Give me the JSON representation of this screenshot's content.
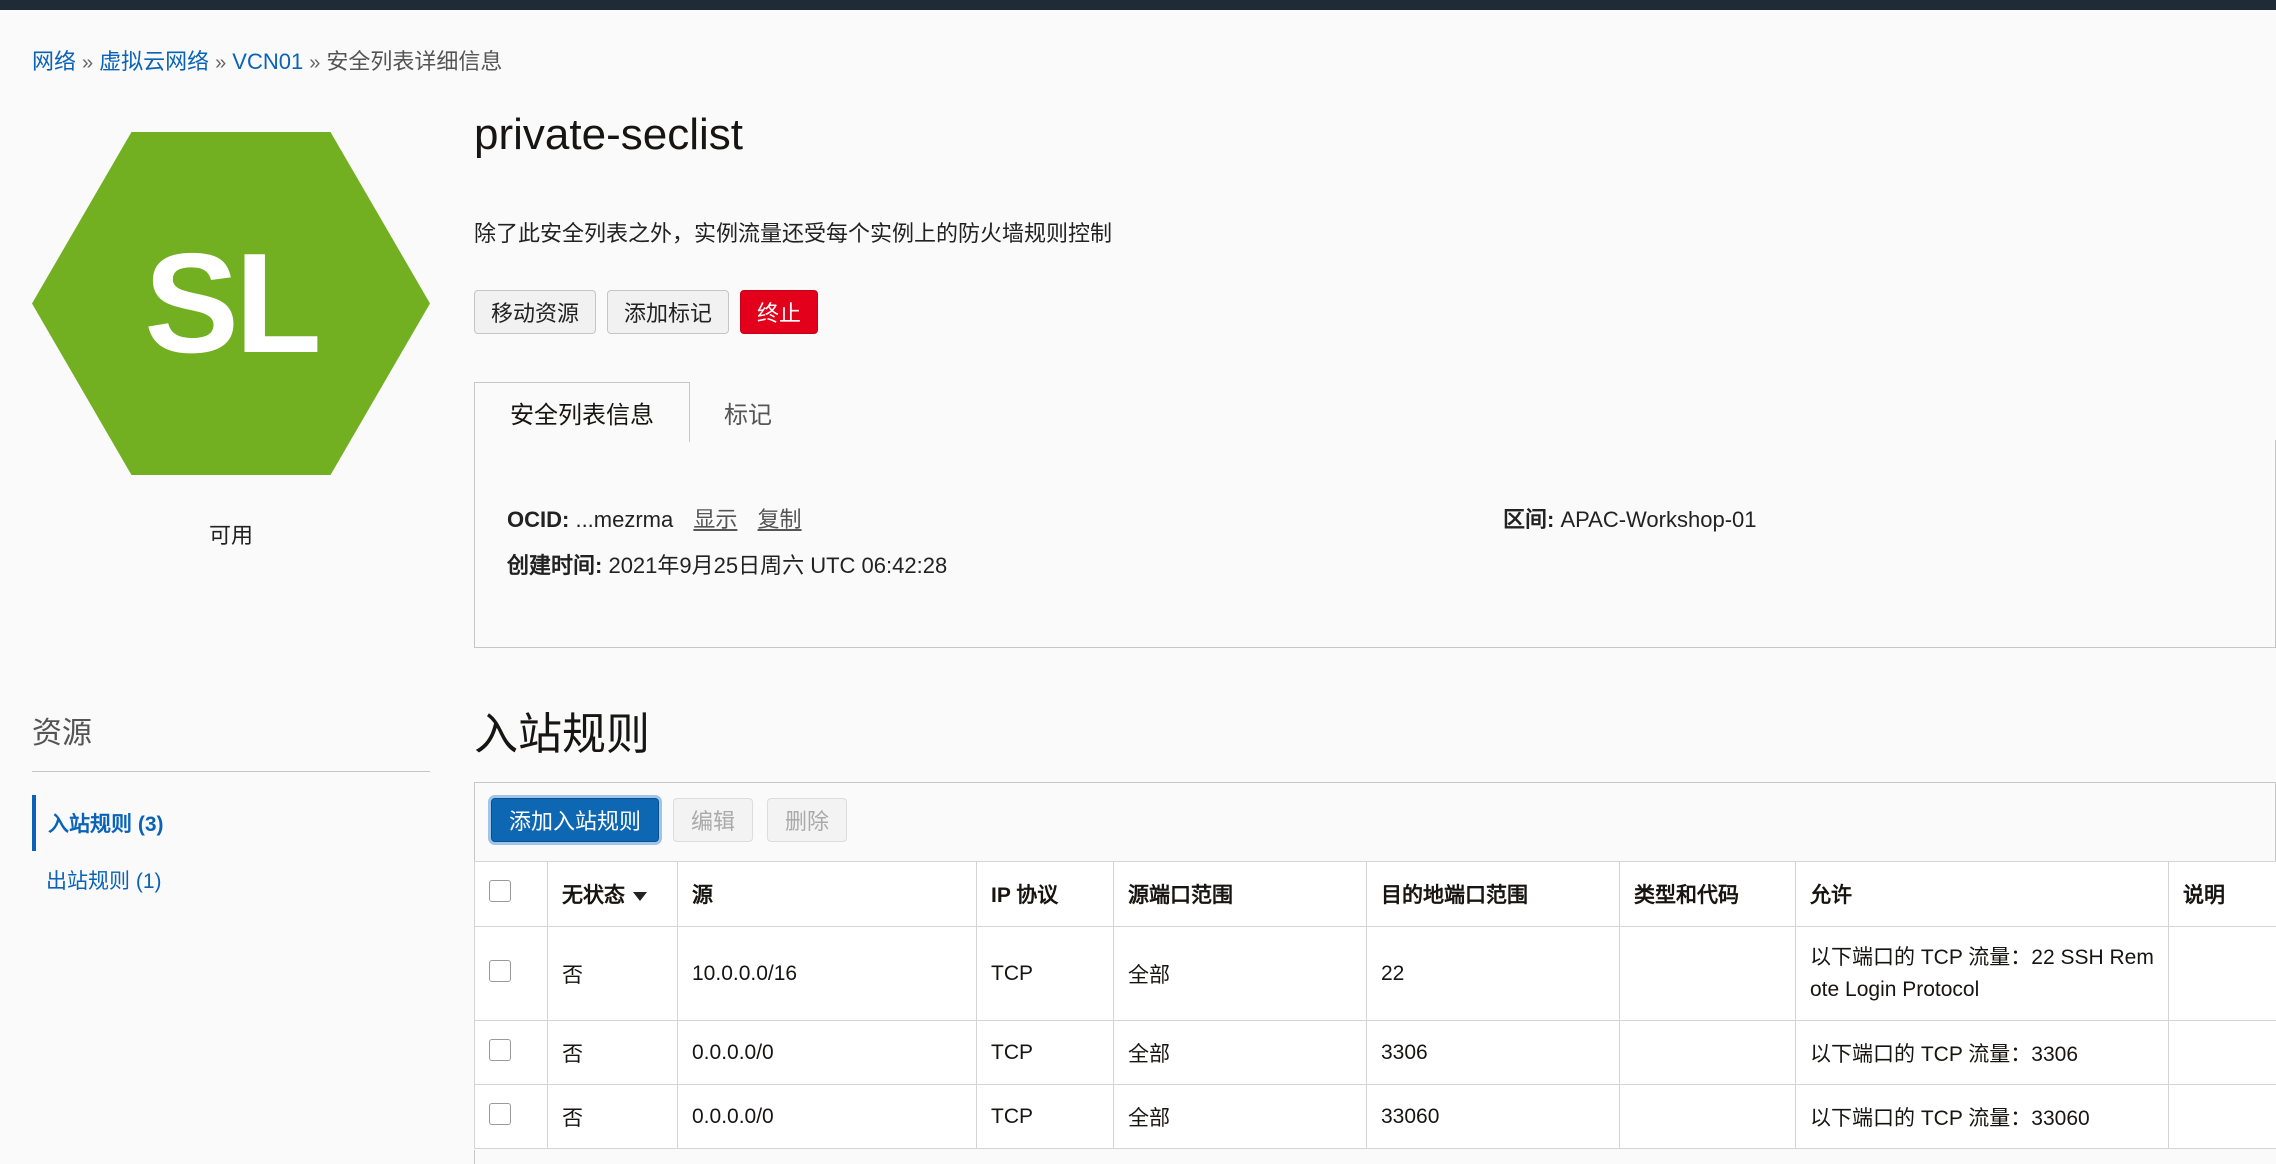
{
  "breadcrumb": {
    "items": [
      "网络",
      "虚拟云网络",
      "VCN01"
    ],
    "separator": "»",
    "current": "安全列表详细信息"
  },
  "resource_icon": {
    "initials": "SL",
    "status": "可用",
    "color": "#72b022"
  },
  "header": {
    "title": "private-seclist",
    "description": "除了此安全列表之外，实例流量还受每个实例上的防火墙规则控制"
  },
  "actions": {
    "move": "移动资源",
    "add_tags": "添加标记",
    "terminate": "终止"
  },
  "tabs": [
    {
      "label": "安全列表信息"
    },
    {
      "label": "标记"
    }
  ],
  "info": {
    "ocid_label": "OCID:",
    "ocid_value": "...mezrma",
    "show": "显示",
    "copy": "复制",
    "compartment_label": "区间:",
    "compartment_value": "APAC-Workshop-01",
    "created_label": "创建时间:",
    "created_value": "2021年9月25日周六 UTC 06:42:28"
  },
  "resources": {
    "title": "资源",
    "items": [
      {
        "label": "入站规则 (3)"
      },
      {
        "label": "出站规则 (1)"
      }
    ]
  },
  "ingress": {
    "title": "入站规则",
    "add_button": "添加入站规则",
    "edit_button": "编辑",
    "delete_button": "删除",
    "columns": [
      "无状态",
      "源",
      "IP 协议",
      "源端口范围",
      "目的地端口范围",
      "类型和代码",
      "允许",
      "说明"
    ],
    "rows": [
      {
        "stateless": "否",
        "source": "10.0.0.0/16",
        "protocol": "TCP",
        "src_port": "全部",
        "dst_port": "22",
        "type_code": "",
        "allows": "以下端口的 TCP 流量：22 SSH Remote Login Protocol",
        "description": ""
      },
      {
        "stateless": "否",
        "source": "0.0.0.0/0",
        "protocol": "TCP",
        "src_port": "全部",
        "dst_port": "3306",
        "type_code": "",
        "allows": "以下端口的 TCP 流量：3306",
        "description": ""
      },
      {
        "stateless": "否",
        "source": "0.0.0.0/0",
        "protocol": "TCP",
        "src_port": "全部",
        "dst_port": "33060",
        "type_code": "",
        "allows": "以下端口的 TCP 流量：33060",
        "description": ""
      }
    ]
  }
}
